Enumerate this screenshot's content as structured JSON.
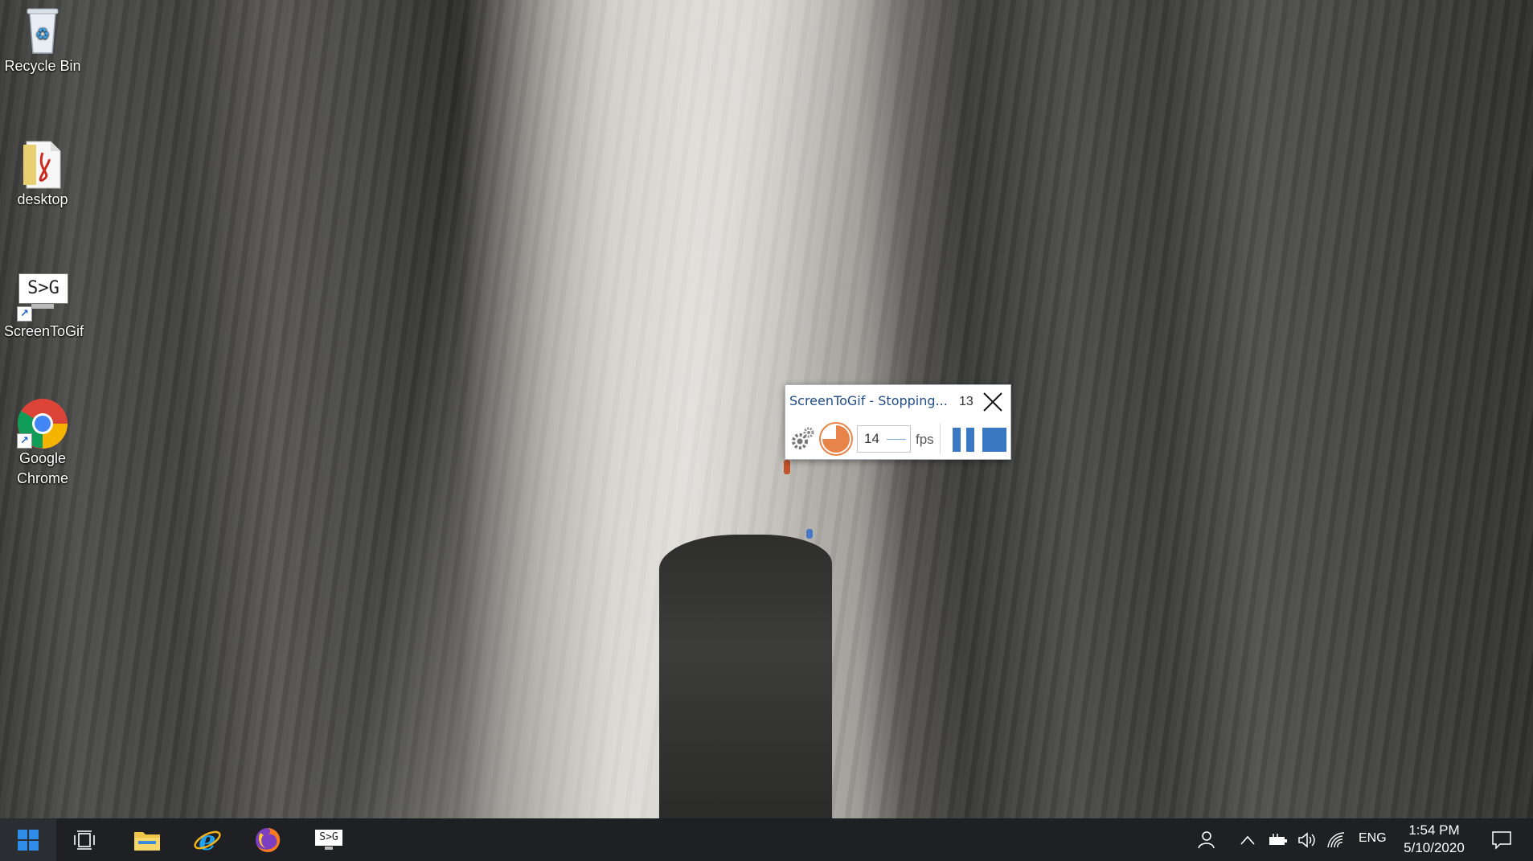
{
  "desktop": {
    "icons": [
      {
        "label": "Recycle Bin"
      },
      {
        "label": "desktop"
      },
      {
        "label": "ScreenToGif",
        "glyph": "S>G"
      },
      {
        "label": "Google Chrome"
      }
    ]
  },
  "recorder": {
    "title": "ScreenToGif - Stopping...",
    "frame_count": "13",
    "fps_value": "14",
    "fps_label": "fps",
    "record_progress": 0.75,
    "accent_color": "#e88449",
    "button_color": "#3a78c4"
  },
  "taskbar": {
    "apps": [
      {
        "name": "task-view-icon"
      },
      {
        "name": "file-explorer-icon"
      },
      {
        "name": "internet-explorer-icon"
      },
      {
        "name": "firefox-icon"
      },
      {
        "name": "screentogif-icon",
        "glyph": "S>G"
      }
    ],
    "language": "ENG",
    "time": "1:54 PM",
    "date": "5/10/2020"
  }
}
